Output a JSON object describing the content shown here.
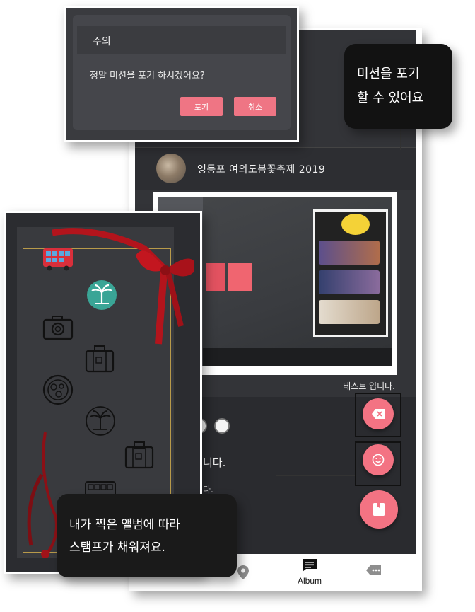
{
  "dialog": {
    "title": "주의",
    "message": "정말 미션을 포기 하시겠어요?",
    "giveup_label": "포기",
    "cancel_label": "취소"
  },
  "callout_top": {
    "line1": "미션을 포기",
    "line2": "할 수 있어요"
  },
  "post": {
    "title": "영등포 여의도봄꽃축제 2019",
    "caption": "테스트 입니다."
  },
  "sheet": {
    "text1": "니다.",
    "text2": "다."
  },
  "bottom_nav": {
    "album_label": "Album",
    "map_icon": "map-pin-icon",
    "album_icon": "chat-square-icon",
    "chat_icon": "message-tag-icon"
  },
  "fabs": {
    "delete_icon": "backspace-icon",
    "emoji_icon": "smile-icon",
    "album_icon": "book-icon"
  },
  "stamps": [
    "bus-icon",
    "palm-tree-icon",
    "camera-icon",
    "suitcase-icon",
    "food-plate-icon",
    "palm-tree-outline-icon",
    "suitcase-icon",
    "bus-outline-icon"
  ],
  "callout_bottom": {
    "line1": "내가 찍은 앨범에 따라",
    "line2": "스탬프가 채워져요."
  },
  "colors": {
    "accent": "#f37383",
    "dark_bg": "#333438",
    "teal_stamp": "#3aa596",
    "ribbon": "#c0161f"
  }
}
